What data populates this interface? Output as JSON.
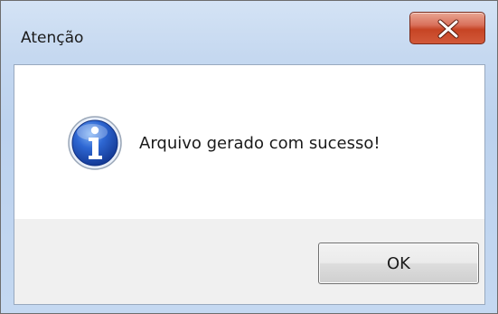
{
  "window": {
    "title": "Atenção",
    "close_icon": "close-icon"
  },
  "dialog": {
    "icon": "info-icon",
    "message": "Arquivo gerado com sucesso!",
    "ok_label": "OK"
  },
  "colors": {
    "close_button": "#c64424",
    "title_bar": "#c5d8f0",
    "footer": "#f0f0f0",
    "info_icon": "#1f4fb8"
  }
}
